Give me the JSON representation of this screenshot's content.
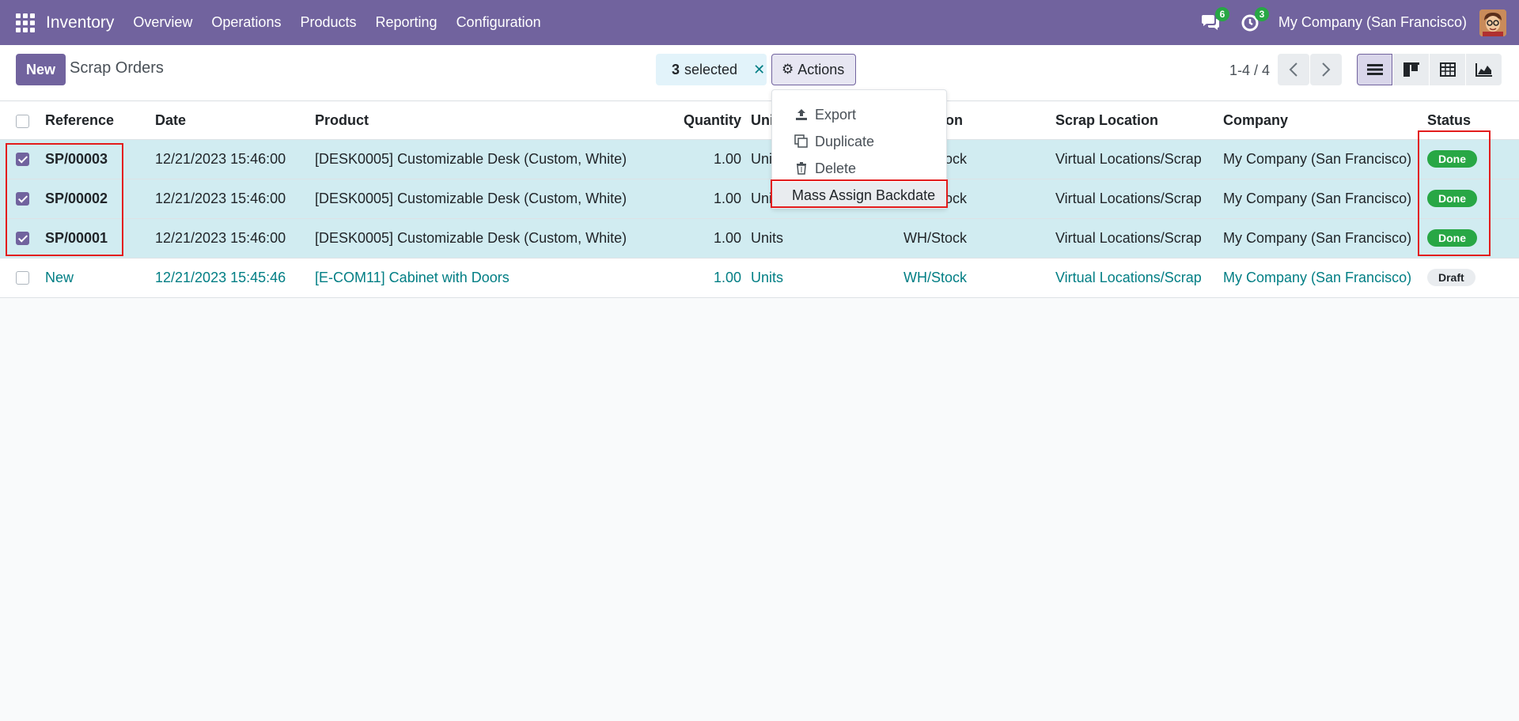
{
  "navbar": {
    "brand": "Inventory",
    "menu": [
      "Overview",
      "Operations",
      "Products",
      "Reporting",
      "Configuration"
    ],
    "messages_count": "6",
    "activities_count": "3",
    "company": "My Company (San Francisco)"
  },
  "control": {
    "new_label": "New",
    "title": "Scrap Orders",
    "selected_count": "3",
    "selected_label": "selected",
    "actions_label": "Actions",
    "pager": "1-4 / 4"
  },
  "dropdown": {
    "items": [
      "Export",
      "Duplicate",
      "Delete",
      "Mass Assign Backdate"
    ]
  },
  "table": {
    "headers": [
      "Reference",
      "Date",
      "Product",
      "Quantity",
      "Unit",
      "Location",
      "Scrap Location",
      "Company",
      "Status"
    ],
    "rows": [
      {
        "ref": "SP/00003",
        "date": "12/21/2023 15:46:00",
        "product": "[DESK0005] Customizable Desk (Custom, White)",
        "qty": "1.00",
        "unit": "Units",
        "location": "WH/Stock",
        "scrap": "Virtual Locations/Scrap",
        "company": "My Company (San Francisco)",
        "status": "Done"
      },
      {
        "ref": "SP/00002",
        "date": "12/21/2023 15:46:00",
        "product": "[DESK0005] Customizable Desk (Custom, White)",
        "qty": "1.00",
        "unit": "Units",
        "location": "WH/Stock",
        "scrap": "Virtual Locations/Scrap",
        "company": "My Company (San Francisco)",
        "status": "Done"
      },
      {
        "ref": "SP/00001",
        "date": "12/21/2023 15:46:00",
        "product": "[DESK0005] Customizable Desk (Custom, White)",
        "qty": "1.00",
        "unit": "Units",
        "location": "WH/Stock",
        "scrap": "Virtual Locations/Scrap",
        "company": "My Company (San Francisco)",
        "status": "Done"
      },
      {
        "ref": "New",
        "date": "12/21/2023 15:45:46",
        "product": "[E-COM11] Cabinet with Doors",
        "qty": "1.00",
        "unit": "Units",
        "location": "WH/Stock",
        "scrap": "Virtual Locations/Scrap",
        "company": "My Company (San Francisco)",
        "status": "Draft"
      }
    ]
  }
}
